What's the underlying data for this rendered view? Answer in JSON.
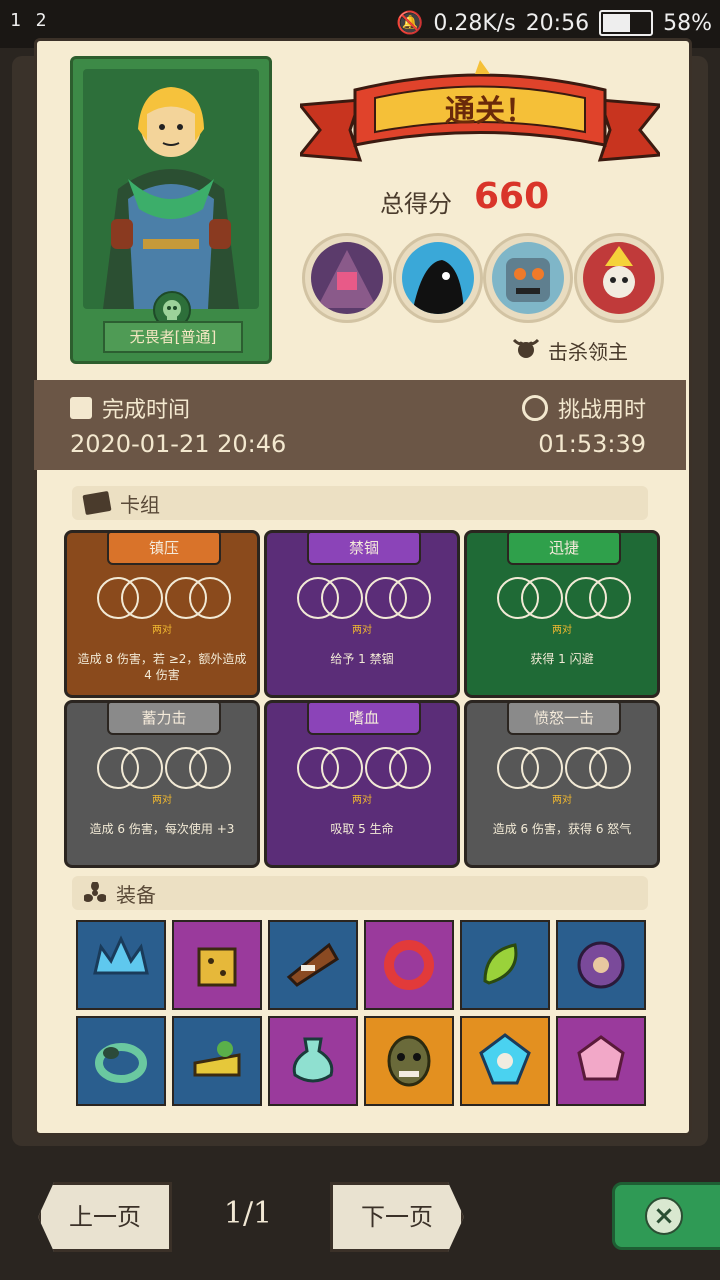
{
  "status_bar": {
    "left": "1 2",
    "net_speed": "0.28K/s",
    "time": "20:56",
    "battery_pct": "58%",
    "battery_level": 0.58
  },
  "result": {
    "hero_name": "无畏者[普通]",
    "banner": "通关！",
    "score_label": "总得分",
    "score": "660",
    "kill_label": "击杀领主"
  },
  "times": {
    "finish_label": "完成时间",
    "finish_value": "2020-01-21 20:46",
    "used_label": "挑战用时",
    "used_value": "01:53:39"
  },
  "deck": {
    "title": "卡组",
    "cards": [
      {
        "name": "镇压",
        "pair": "两对",
        "desc": "造成 8 伤害，若 ≥2，额外造成 4 伤害",
        "color": "#8a4a1c",
        "tab": "#d9732a"
      },
      {
        "name": "禁锢",
        "pair": "两对",
        "desc": "给予 1 禁锢",
        "color": "#5b2d78",
        "tab": "#8b44b8"
      },
      {
        "name": "迅捷",
        "pair": "两对",
        "desc": "获得 1 闪避",
        "color": "#1f6a36",
        "tab": "#2fa04b"
      },
      {
        "name": "蓄力击",
        "pair": "两对",
        "desc": "造成 6 伤害，每次使用 +3",
        "color": "#575757",
        "tab": "#8a8a8a"
      },
      {
        "name": "嗜血",
        "pair": "两对",
        "desc": "吸取 5 生命",
        "color": "#5b2d78",
        "tab": "#8b44b8"
      },
      {
        "name": "愤怒一击",
        "pair": "两对",
        "desc": "造成 6 伤害，获得 6 怒气",
        "color": "#575757",
        "tab": "#8a8a8a"
      }
    ]
  },
  "equipment": {
    "title": "装备",
    "items": [
      {
        "icon": "crown-icon",
        "color": "blue"
      },
      {
        "icon": "dice-icon",
        "color": "purple"
      },
      {
        "icon": "horn-icon",
        "color": "blue"
      },
      {
        "icon": "ring-icon",
        "color": "purple"
      },
      {
        "icon": "leaf-icon",
        "color": "blue"
      },
      {
        "icon": "shield-icon",
        "color": "blue"
      },
      {
        "icon": "emerald-ring-icon",
        "color": "blue"
      },
      {
        "icon": "cheese-icon",
        "color": "blue"
      },
      {
        "icon": "potion-icon",
        "color": "purple"
      },
      {
        "icon": "mask-icon",
        "color": "orange"
      },
      {
        "icon": "gem-skull-icon",
        "color": "orange"
      },
      {
        "icon": "crystal-icon",
        "color": "purple"
      }
    ]
  },
  "nav": {
    "prev": "上一页",
    "page": "1/1",
    "next": "下一页"
  }
}
